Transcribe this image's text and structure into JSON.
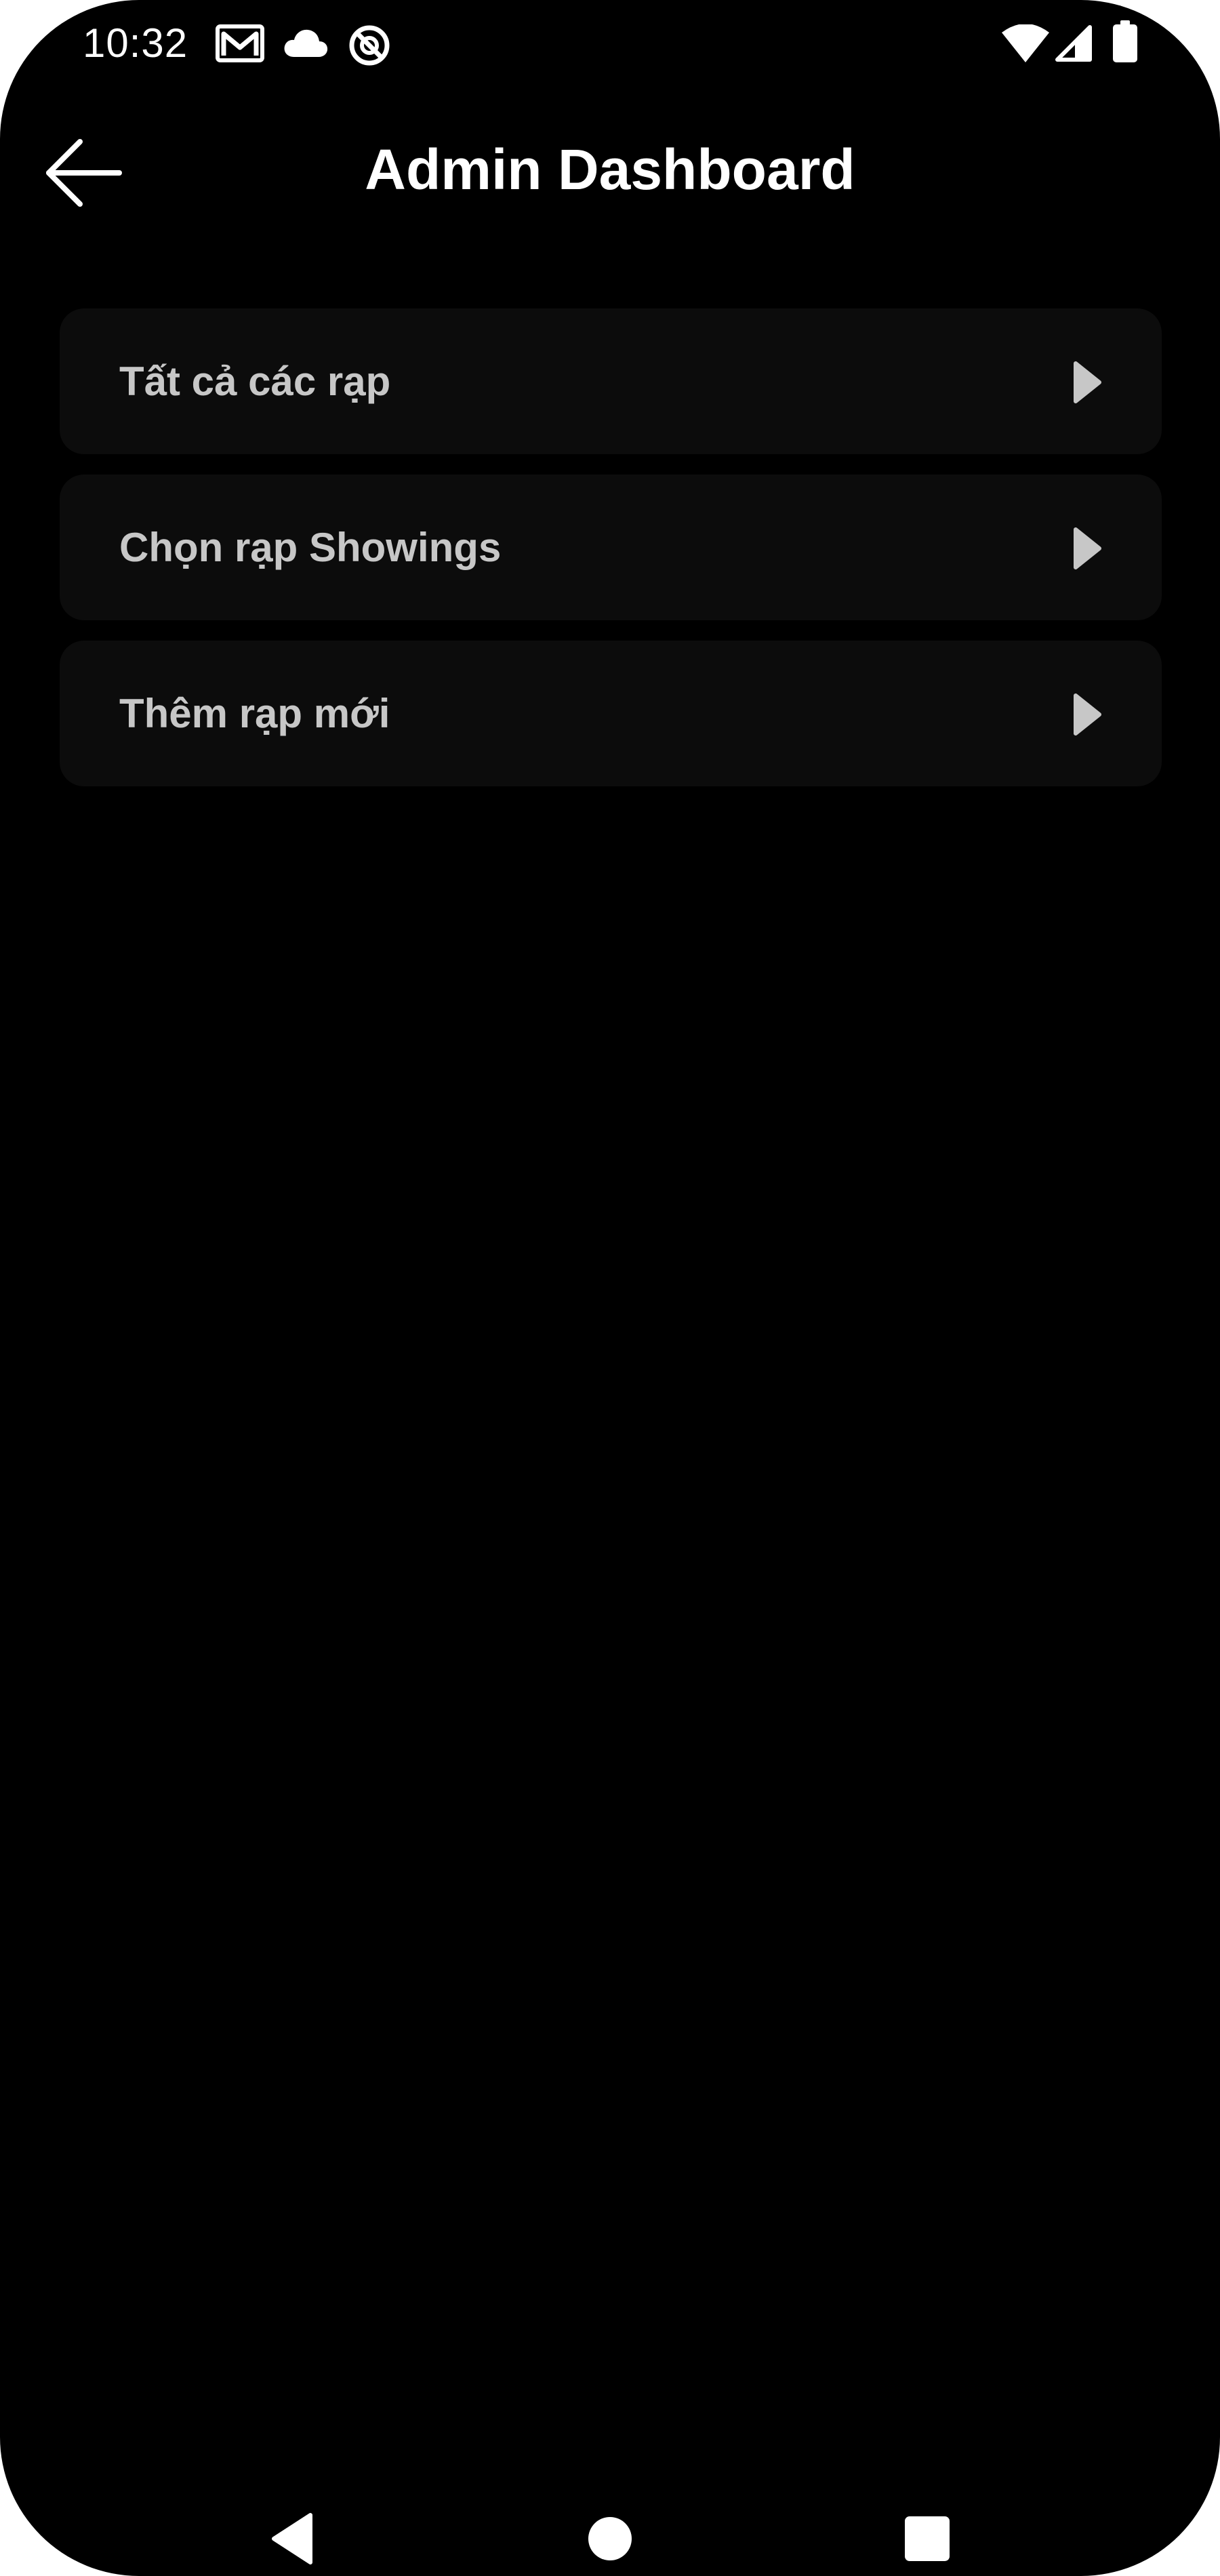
{
  "status_bar": {
    "time": "10:32",
    "left_icons": [
      "gmail-icon",
      "cloud-icon",
      "no-sync-icon"
    ],
    "right_icons": [
      "wifi-icon",
      "cellular-signal-icon",
      "battery-icon"
    ]
  },
  "app_bar": {
    "back_icon": "arrow-left-icon",
    "title": "Admin Dashboard"
  },
  "menu": {
    "items": [
      {
        "label": "Tất cả các rạp",
        "icon": "play-arrow-icon"
      },
      {
        "label": "Chọn rạp Showings",
        "icon": "play-arrow-icon"
      },
      {
        "label": "Thêm rạp mới",
        "icon": "play-arrow-icon"
      }
    ]
  },
  "nav_bar": {
    "buttons": [
      "nav-back-icon",
      "nav-home-icon",
      "nav-recents-icon"
    ]
  },
  "colors": {
    "background": "#000000",
    "card": "#0c0c0c",
    "title_text": "#ffffff",
    "item_text": "#c7c7c7",
    "arrow": "#c7c7c7"
  }
}
